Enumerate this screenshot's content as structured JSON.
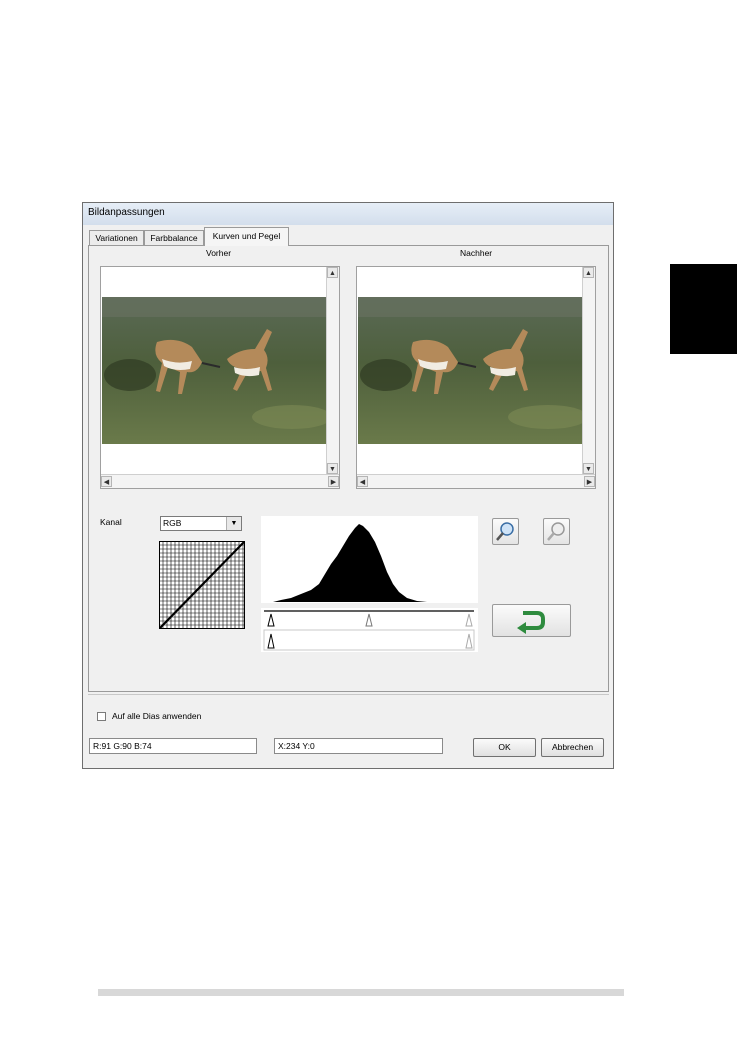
{
  "dialog": {
    "title": "Bildanpassungen",
    "tabs": [
      {
        "label": "Variationen",
        "active": false
      },
      {
        "label": "Farbbalance",
        "active": false
      },
      {
        "label": "Kurven und Pegel",
        "active": true
      }
    ],
    "preview_before_label": "Vorher",
    "preview_after_label": "Nachher",
    "channel": {
      "label": "Kanal",
      "selected": "RGB"
    },
    "histogram": {
      "slider_top_markers": 3,
      "slider_bottom_markers": 2
    },
    "buttons": {
      "zoom_in_icon": "zoom-in-icon",
      "zoom_out_icon": "zoom-out-icon",
      "reset_icon": "reset-arrow-icon",
      "ok_label": "OK",
      "cancel_label": "Abbrechen"
    },
    "apply_all": {
      "label": "Auf alle Dias anwenden",
      "checked": false
    },
    "status": {
      "rgb": "R:91 G:90 B:74",
      "coords": "X:234 Y:0"
    },
    "colors": {
      "reset_arrow": "#2e8b3e",
      "titlebar": "#dbe5f1"
    }
  }
}
